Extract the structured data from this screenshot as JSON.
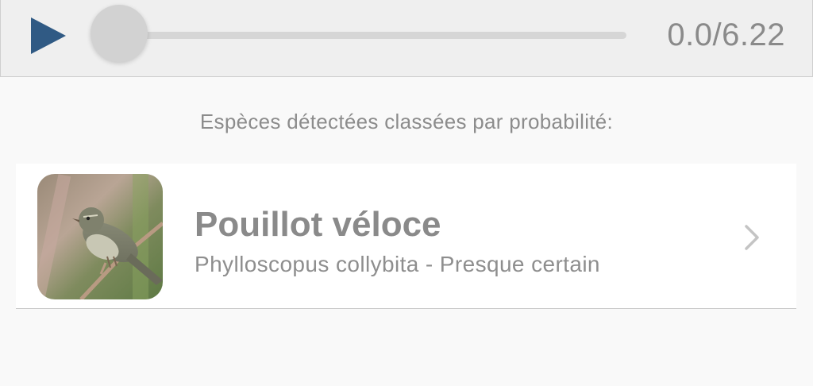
{
  "player": {
    "time_display": "0.0/6.22",
    "progress": 0,
    "accent_color": "#305a84",
    "play_icon": "play-icon"
  },
  "results": {
    "heading": "Espèces détectées classées par probabilité:",
    "items": [
      {
        "common_name": "Pouillot véloce",
        "scientific_line": "Phylloscopus collybita - Presque certain",
        "image_icon": "bird-photo",
        "chevron_icon": "chevron-right-icon"
      }
    ]
  }
}
